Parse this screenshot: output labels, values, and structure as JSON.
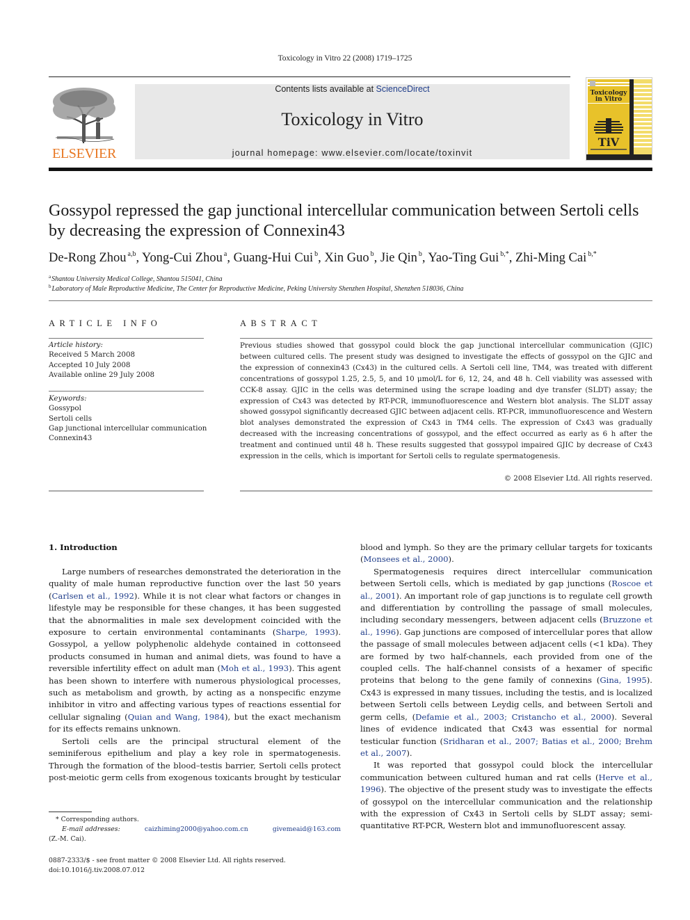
{
  "header": {
    "running_head": "Toxicology in Vitro 22 (2008) 1719–1725",
    "publisher_logo": "ELSEVIER",
    "contents_prefix": "Contents lists available at ",
    "contents_link": "ScienceDirect",
    "journal_title": "Toxicology in Vitro",
    "homepage": "journal homepage: www.elsevier.com/locate/toxinvit",
    "cover": {
      "title_line1": "Toxicology",
      "title_line2": "in Vitro",
      "logo_text": "TiV",
      "accent_color": "#e8c22a"
    }
  },
  "article": {
    "title": "Gossypol repressed the gap junctional intercellular communication between Sertoli cells by decreasing the expression of Connexin43",
    "authors": [
      {
        "name": "De-Rong Zhou",
        "sup": "a,b",
        "sep": ", "
      },
      {
        "name": "Yong-Cui Zhou",
        "sup": "a",
        "sep": ", "
      },
      {
        "name": "Guang-Hui Cui",
        "sup": "b",
        "sep": ", "
      },
      {
        "name": "Xin Guo",
        "sup": "b",
        "sep": ", "
      },
      {
        "name": "Jie Qin",
        "sup": "b",
        "sep": ", "
      },
      {
        "name": "Yao-Ting Gui",
        "sup": "b,*",
        "sep": ", "
      },
      {
        "name": "Zhi-Ming Cai",
        "sup": "b,*",
        "sep": ""
      }
    ],
    "affiliations": [
      {
        "mark": "a",
        "text": "Shantou University Medical College, Shantou 515041, China"
      },
      {
        "mark": "b",
        "text": "Laboratory of Male Reproductive Medicine, The Center for Reproductive Medicine, Peking University Shenzhen Hospital, Shenzhen 518036, China"
      }
    ]
  },
  "article_info": {
    "heading": "ARTICLE INFO",
    "history_label": "Article history:",
    "history": [
      "Received 5 March 2008",
      "Accepted 10 July 2008",
      "Available online 29 July 2008"
    ],
    "keywords_label": "Keywords:",
    "keywords": [
      "Gossypol",
      "Sertoli cells",
      "Gap junctional intercellular communication",
      "Connexin43"
    ]
  },
  "abstract": {
    "heading": "ABSTRACT",
    "text": "Previous studies showed that gossypol could block the gap junctional intercellular communication (GJIC) between cultured cells. The present study was designed to investigate the effects of gossypol on the GJIC and the expression of connexin43 (Cx43) in the cultured cells. A Sertoli cell line, TM4, was treated with different concentrations of gossypol 1.25, 2.5, 5, and 10 μmol/L for 6, 12, 24, and 48 h. Cell viability was assessed with CCK-8 assay. GJIC in the cells was determined using the scrape loading and dye transfer (SLDT) assay; the expression of Cx43 was detected by RT-PCR, immunofluorescence and Western blot analysis. The SLDT assay showed gossypol significantly decreased GJIC between adjacent cells. RT-PCR, immunofluorescence and Western blot analyses demonstrated the expression of Cx43 in TM4 cells. The expression of Cx43 was gradually decreased with the increasing concentrations of gossypol, and the effect occurred as early as 6 h after the treatment and continued until 48 h. These results suggested that gossypol impaired GJIC by decrease of Cx43 expression in the cells, which is important for Sertoli cells to regulate spermatogenesis.",
    "copyright": "© 2008 Elsevier Ltd. All rights reserved."
  },
  "body": {
    "section_heading": "1. Introduction",
    "left_paragraphs": [
      [
        {
          "t": "Large numbers of researches demonstrated the deterioration in the quality of male human reproductive function over the last 50 years ("
        },
        {
          "c": "Carlsen et al., 1992"
        },
        {
          "t": "). While it is not clear what factors or changes in lifestyle may be responsible for these changes, it has been suggested that the abnormalities in male sex development coincided with the exposure to certain environmental contaminants ("
        },
        {
          "c": "Sharpe, 1993"
        },
        {
          "t": "). Gossypol, a yellow polyphenolic aldehyde contained in cottonseed products consumed in human and animal diets, was found to have a reversible infertility effect on adult man ("
        },
        {
          "c": "Moh et al., 1993"
        },
        {
          "t": "). This agent has been shown to interfere with numerous physiological processes, such as metabolism and growth, by acting as a nonspecific enzyme inhibitor in vitro and affecting various types of reactions essential for cellular signaling ("
        },
        {
          "c": "Quian and Wang, 1984"
        },
        {
          "t": "), but the exact mechanism for its effects remains unknown."
        }
      ],
      [
        {
          "t": "Sertoli cells are the principal structural element of the seminiferous epithelium and play a key role in spermatogenesis. Through the formation of the blood–testis barrier, Sertoli cells protect post-meiotic germ cells from exogenous toxicants brought by testicular"
        }
      ]
    ],
    "right_paragraphs": [
      [
        {
          "t": "blood and lymph. So they are the primary cellular targets for toxicants ("
        },
        {
          "c": "Monsees et al., 2000"
        },
        {
          "t": ")."
        }
      ],
      [
        {
          "t": "Spermatogenesis requires direct intercellular communication between Sertoli cells, which is mediated by gap junctions ("
        },
        {
          "c": "Roscoe et al., 2001"
        },
        {
          "t": "). An important role of gap junctions is to regulate cell growth and differentiation by controlling the passage of small molecules, including secondary messengers, between adjacent cells ("
        },
        {
          "c": "Bruzzone et al., 1996"
        },
        {
          "t": "). Gap junctions are composed of intercellular pores that allow the passage of small molecules between adjacent cells (<1 kDa). They are formed by two half-channels, each provided from one of the coupled cells. The half-channel consists of a hexamer of specific proteins that belong to the gene family of connexins ("
        },
        {
          "c": "Gina, 1995"
        },
        {
          "t": "). Cx43 is expressed in many tissues, including the testis, and is localized between Sertoli cells between Leydig cells, and between Sertoli and germ cells, ("
        },
        {
          "c": "Defamie et al., 2003; Cristancho et al., 2000"
        },
        {
          "t": "). Several lines of evidence indicated that Cx43 was essential for normal testicular function ("
        },
        {
          "c": "Sridharan et al., 2007; Batias et al., 2000; Brehm et al., 2007"
        },
        {
          "t": ")."
        }
      ],
      [
        {
          "t": "It was reported that gossypol could block the intercellular communication between cultured human and rat cells ("
        },
        {
          "c": "Herve et al., 1996"
        },
        {
          "t": "). The objective of the present study was to investigate the effects of gossypol on the intercellular communication and the relationship with the expression of Cx43 in Sertoli cells by SLDT assay; semi-quantitative RT-PCR, Western blot and immunofluorescent assay."
        }
      ]
    ]
  },
  "footnotes": {
    "corresponding": "* Corresponding authors.",
    "email_label": "E-mail addresses:",
    "emails": [
      "caizhiming2000@yahoo.com.cn",
      "givemeaid@163.com"
    ],
    "email_owner": "(Z.-M. Cai).",
    "front_matter": "0887-2333/$ - see front matter © 2008 Elsevier Ltd. All rights reserved.",
    "doi": "doi:10.1016/j.tiv.2008.07.012"
  }
}
